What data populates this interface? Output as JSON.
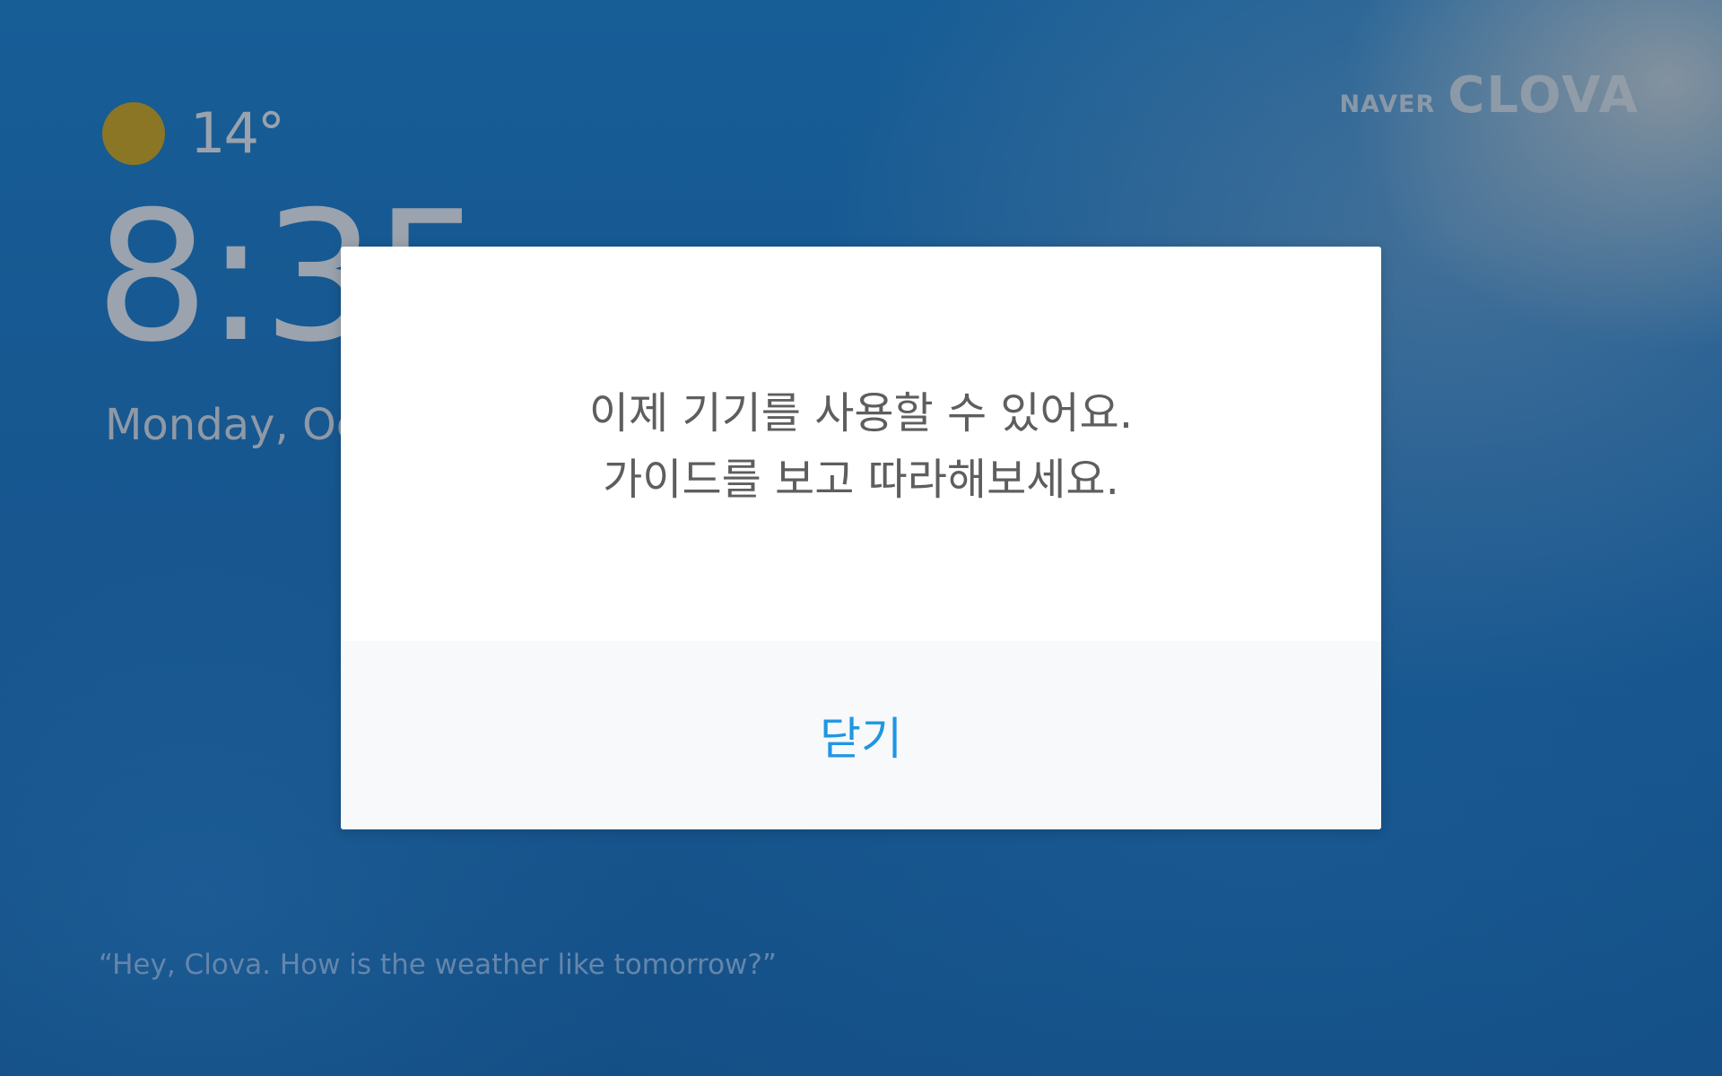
{
  "brand": {
    "naver": "NAVER",
    "clova": "CLOVA"
  },
  "weather": {
    "icon": "sun-icon",
    "temperature": "14°"
  },
  "clock": {
    "time": "8:35"
  },
  "date": {
    "text": "Monday, Oc"
  },
  "hint": {
    "text": "“Hey, Clova. How is the weather like tomorrow?”"
  },
  "dialog": {
    "line1": "이제 기기를 사용할 수 있어요.",
    "line2": "가이드를 보고 따라해보세요.",
    "close_label": "닫기"
  },
  "colors": {
    "background": "#175a93",
    "accent": "#1f96e4",
    "sun": "#8a7625",
    "dialog_text": "#5e5e5e"
  }
}
